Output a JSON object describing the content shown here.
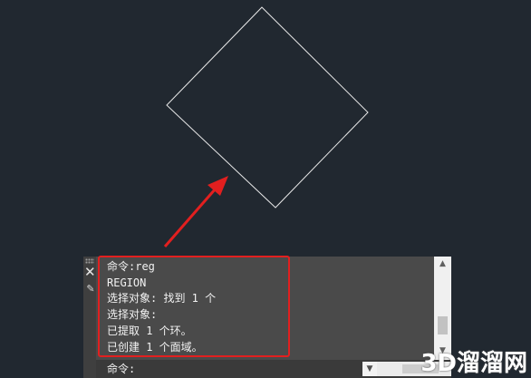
{
  "colors": {
    "canvas_bg": "#212830",
    "shape_stroke": "#e8e8e8",
    "highlight": "#e21f1f",
    "panel_bg": "#4d4d4d",
    "text": "#f2f2f2"
  },
  "icons": {
    "close": "close-icon",
    "pencil": "pencil-icon",
    "scroll_up": "chevron-up-icon",
    "scroll_down": "chevron-down-icon",
    "dropdown": "chevron-down-icon"
  },
  "command_window": {
    "history": [
      "命令:reg",
      "REGION",
      "选择对象: 找到 1 个",
      "选择对象:",
      "已提取 1 个环。",
      "已创建 1 个面域。"
    ],
    "prompt": "命令:",
    "input_value": ""
  },
  "watermark": "3D溜溜网"
}
